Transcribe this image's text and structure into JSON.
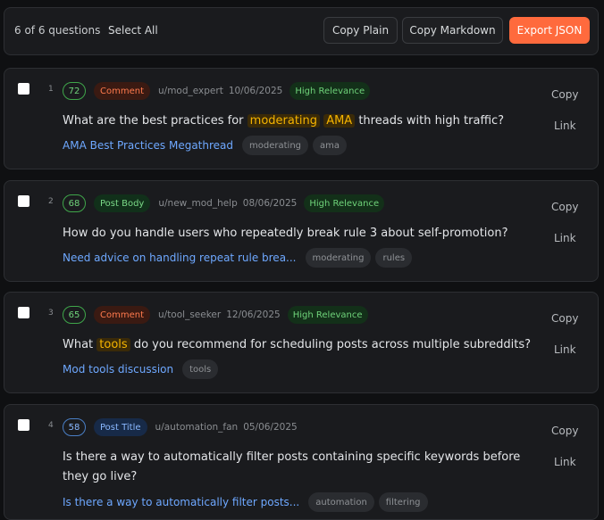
{
  "toolbar": {
    "count_label": "6 of 6 questions",
    "select_all": "Select All",
    "copy_plain": "Copy Plain",
    "copy_markdown": "Copy Markdown",
    "export_json": "Export JSON"
  },
  "colors": {
    "accent_orange": "#ff6a3d",
    "highlight": "#f5b400",
    "link_blue": "#6ea8ff",
    "relevance_green": "#6fd37a"
  },
  "questions": [
    {
      "index": "1",
      "score": "72",
      "type": "Comment",
      "author": "u/mod_expert",
      "date": "10/06/2025",
      "relevance": "High Relevance",
      "text_parts": [
        "What are the best practices for ",
        "moderating",
        " ",
        "AMA",
        " threads with high traffic?"
      ],
      "thread": "AMA Best Practices Megathread",
      "tags": [
        "moderating",
        "ama"
      ],
      "copy": "Copy",
      "link": "Link"
    },
    {
      "index": "2",
      "score": "68",
      "type": "Post Body",
      "author": "u/new_mod_help",
      "date": "08/06/2025",
      "relevance": "High Relevance",
      "text": "How do you handle users who repeatedly break rule 3 about self-promotion?",
      "thread": "Need advice on handling repeat rule brea...",
      "tags": [
        "moderating",
        "rules"
      ],
      "copy": "Copy",
      "link": "Link"
    },
    {
      "index": "3",
      "score": "65",
      "type": "Comment",
      "author": "u/tool_seeker",
      "date": "12/06/2025",
      "relevance": "High Relevance",
      "text_parts": [
        "What ",
        "tools",
        " do you recommend for scheduling posts across multiple subreddits?"
      ],
      "thread": "Mod tools discussion",
      "tags": [
        "tools"
      ],
      "copy": "Copy",
      "link": "Link"
    },
    {
      "index": "4",
      "score": "58",
      "type": "Post Title",
      "author": "u/automation_fan",
      "date": "05/06/2025",
      "text": "Is there a way to automatically filter posts containing specific keywords before they go live?",
      "thread": "Is there a way to automatically filter posts...",
      "tags": [
        "automation",
        "filtering"
      ],
      "copy": "Copy",
      "link": "Link"
    }
  ]
}
